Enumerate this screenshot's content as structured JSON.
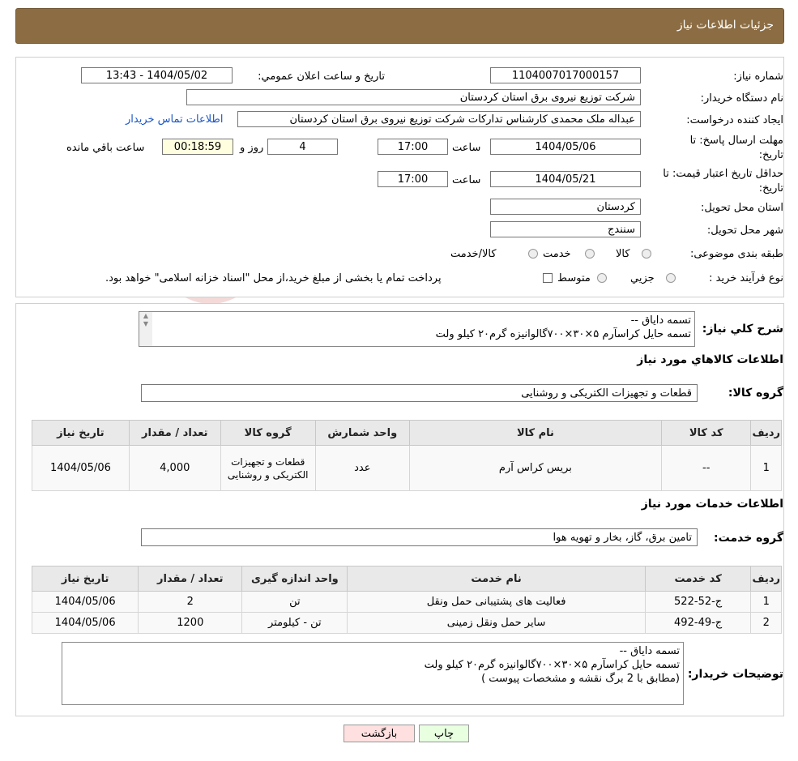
{
  "header": {
    "title": "جزئیات اطلاعات نیاز"
  },
  "form": {
    "need_number_label": "شماره نیاز:",
    "need_number": "1104007017000157",
    "announce_label": "تاریخ و ساعت اعلان عمومي:",
    "announce_value": "1404/05/02 - 13:43",
    "buyer_label": "نام دستگاه خريدار:",
    "buyer_value": "شرکت توزیع نیروی برق استان کردستان",
    "creator_label": "ایجاد کننده درخواست:",
    "creator_value": "عبداله ملک محمدی کارشناس تدارکات شرکت توزیع نیروی برق استان کردستان",
    "contact_link": "اطلاعات تماس خریدار",
    "deadline_label_1": "مهلت ارسال پاسخ: تا",
    "deadline_label_2": "تاریخ:",
    "deadline_date": "1404/05/06",
    "time_label": "ساعت",
    "deadline_time": "17:00",
    "days_value": "4",
    "days_label": "روز و",
    "remaining_time": "00:18:59",
    "remaining_label": "ساعت باقي مانده",
    "validity_label_1": "حداقل تاريخ اعتبار قيمت: تا",
    "validity_label_2": "تاريخ:",
    "validity_date": "1404/05/21",
    "validity_time": "17:00",
    "province_label": "استان محل تحويل:",
    "province_value": "کردستان",
    "city_label": "شهر محل تحويل:",
    "city_value": "سنندج",
    "category_label": "طبقه بندی موضوعی:",
    "category_options": [
      "کالا",
      "خدمت",
      "کالا/خدمت"
    ],
    "process_label": "نوع فرآیند خرید :",
    "process_options": [
      "جزيي",
      "متوسط"
    ],
    "process_note": "پرداخت تمام يا بخشی از مبلغ خريد،از محل \"اسناد خزانه اسلامی\" خواهد بود."
  },
  "description": {
    "label": "شرح کلي نياز:",
    "lines": [
      "تسمه دایاق --",
      "تسمه حایل کراسآرم ۵×۳۰×۷۰۰گالوانیزه گرم۲۰ کیلو ولت"
    ]
  },
  "goods": {
    "section_title": "اطلاعات کالاهاي مورد نياز",
    "group_label": "گروه کالا:",
    "group_value": "قطعات و تجهیزات الکتریکی و روشنایی",
    "headers": [
      "رديف",
      "کد کالا",
      "نام کالا",
      "واحد شمارش",
      "گروه کالا",
      "تعداد / مقدار",
      "تاريخ نياز"
    ],
    "rows": [
      [
        "1",
        "--",
        "بریس کراس آرم",
        "عدد",
        "قطعات و تجهیزات الکتریکی و روشنایی",
        "4,000",
        "1404/05/06"
      ]
    ]
  },
  "services": {
    "section_title": "اطلاعات خدمات مورد نياز",
    "group_label": "گروه خدمت:",
    "group_value": "تامین برق، گاز، بخار و تهویه هوا",
    "headers": [
      "رديف",
      "کد خدمت",
      "نام خدمت",
      "واحد اندازه گيری",
      "تعداد / مقدار",
      "تاريخ نياز"
    ],
    "rows": [
      [
        "1",
        "ج-52-522",
        "فعالیت های پشتیبانی حمل ونقل",
        "تن",
        "2",
        "1404/05/06"
      ],
      [
        "2",
        "ج-49-492",
        "سایر حمل ونقل زمینی",
        "تن - کیلومتر",
        "1200",
        "1404/05/06"
      ]
    ]
  },
  "buyer_notes": {
    "label": "توضيحات خريدار:",
    "lines": [
      "تسمه دایاق --",
      "تسمه حایل کراسآرم ۵×۳۰×۷۰۰گالوانیزه گرم۲۰ کیلو ولت",
      "(مطابق با 2 برگ نقشه و مشخصات  پیوست )"
    ]
  },
  "buttons": {
    "print": "چاپ",
    "back": "بازگشت"
  },
  "colors": {
    "header_bg": "#8c6d43",
    "link": "#1a56c8",
    "back_button": "#ffe0e0",
    "print_button": "#e8ffe0"
  }
}
